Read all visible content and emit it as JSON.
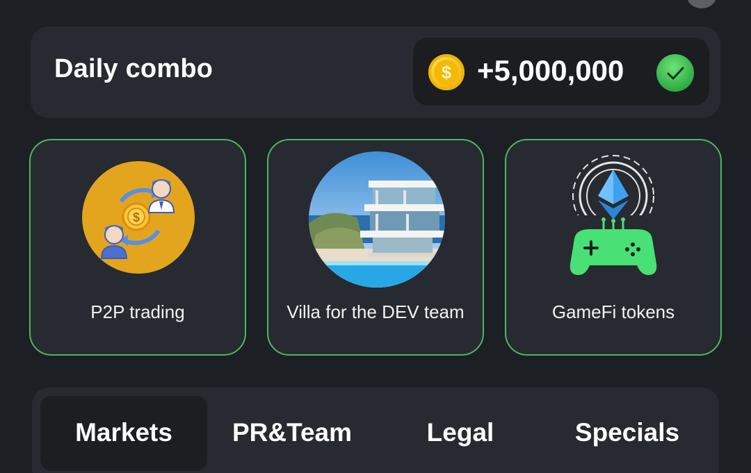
{
  "daily_combo": {
    "title": "Daily combo",
    "reward": "+5,000,000",
    "coin_symbol": "$",
    "claimed": true,
    "accent_color": "#4fb660"
  },
  "cards": [
    {
      "label": "P2P trading",
      "icon": "p2p-trading-illustration"
    },
    {
      "label": "Villa for the DEV team",
      "icon": "villa-photo"
    },
    {
      "label": "GameFi tokens",
      "icon": "gamefi-ethereum-gamepad-illustration"
    }
  ],
  "tabs": [
    {
      "label": "Markets",
      "active": true
    },
    {
      "label": "PR&Team",
      "active": false
    },
    {
      "label": "Legal",
      "active": false
    },
    {
      "label": "Specials",
      "active": false
    }
  ]
}
